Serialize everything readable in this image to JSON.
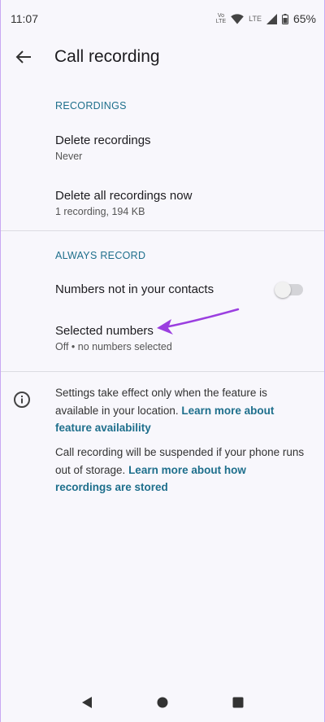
{
  "status_bar": {
    "time": "11:07",
    "volte_line1": "Vo",
    "volte_line2": "LTE",
    "lte_label": "LTE",
    "battery_percent": "65%"
  },
  "app_bar": {
    "title": "Call recording"
  },
  "recordings_section": {
    "header": "RECORDINGS",
    "items": [
      {
        "title": "Delete recordings",
        "summary": "Never"
      },
      {
        "title": "Delete all recordings now",
        "summary": "1 recording, 194 KB"
      }
    ]
  },
  "always_record_section": {
    "header": "ALWAYS RECORD",
    "numbers_not_in_contacts": {
      "title": "Numbers not in your contacts",
      "enabled": false
    },
    "selected_numbers": {
      "title": "Selected numbers",
      "summary": "Off • no numbers selected"
    }
  },
  "info": {
    "paragraph1_text": "Settings take effect only when the feature is available in your location. ",
    "paragraph1_link": "Learn more about feature availability",
    "paragraph2_text": "Call recording will be suspended if your phone runs out of storage. ",
    "paragraph2_link": "Learn more about how recordings are stored"
  },
  "colors": {
    "accent": "#1e6f8c",
    "annotation_arrow": "#9b3fe0"
  }
}
